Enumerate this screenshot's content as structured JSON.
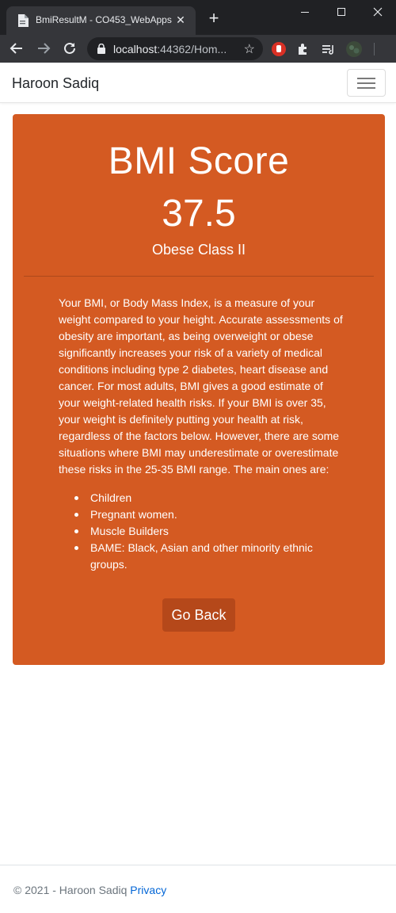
{
  "browser": {
    "tab_title": "BmiResultM - CO453_WebApps",
    "url_host": "localhost",
    "url_rest": ":44362/Hom..."
  },
  "navbar": {
    "brand": "Haroon Sadiq"
  },
  "result": {
    "heading": "BMI Score",
    "score": "37.5",
    "category": "Obese Class II",
    "description": "Your BMI, or Body Mass Index, is a measure of your weight compared to your height. Accurate assessments of obesity are important, as being overweight or obese significantly increases your risk of a variety of medical conditions including type 2 diabetes, heart disease and cancer. For most adults, BMI gives a good estimate of your weight-related health risks. If your BMI is over 35, your weight is definitely putting your health at risk, regardless of the factors below. However, there are some situations where BMI may underestimate or overestimate these risks in the 25-35 BMI range. The main ones are:",
    "exceptions": [
      "Children",
      "Pregnant women.",
      "Muscle Builders",
      "BAME: Black, Asian and other minority ethnic groups."
    ],
    "back_label": "Go Back"
  },
  "footer": {
    "copyright": "© 2021 - Haroon Sadiq",
    "privacy_label": "Privacy"
  },
  "colors": {
    "card_background": "#d45a22",
    "button_background": "#b5481a",
    "link": "#0366d6"
  }
}
